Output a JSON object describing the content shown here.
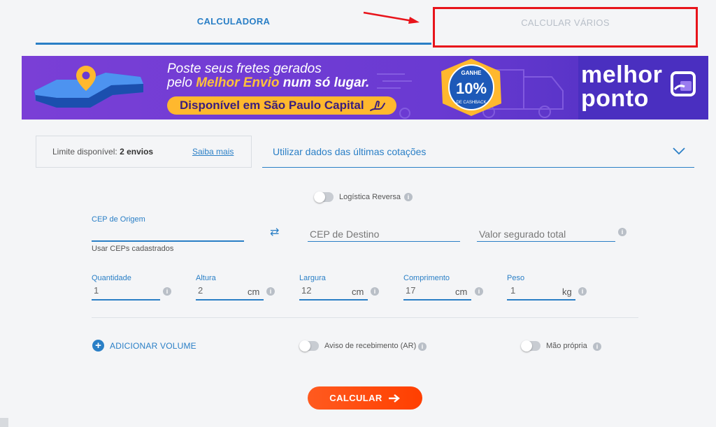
{
  "tabs": {
    "calculadora": "CALCULADORA",
    "calcular_varios": "CALCULAR VÁRIOS"
  },
  "banner": {
    "line1": "Poste seus fretes gerados",
    "line2_pre": "pelo ",
    "line2_brand": "Melhor Envio",
    "line2_post": " num só lugar.",
    "pill": "Disponível em São Paulo Capital",
    "badge_top": "GANHE",
    "badge_value": "10%",
    "badge_bottom": "DE CASHBACK",
    "brand_word1": "melhor",
    "brand_word2": "ponto"
  },
  "limit": {
    "label": "Limite disponível:",
    "value": "2 envios",
    "link": "Saiba mais"
  },
  "quotes": {
    "placeholder": "Utilizar dados das últimas cotações"
  },
  "reverse": {
    "label": "Logística Reversa"
  },
  "origin": {
    "label": "CEP de Origem",
    "value": "",
    "hint": "Usar CEPs cadastrados"
  },
  "destination": {
    "placeholder": "CEP de Destino"
  },
  "insured": {
    "placeholder": "Valor segurado total"
  },
  "dims": {
    "quantidade": {
      "label": "Quantidade",
      "value": "1"
    },
    "altura": {
      "label": "Altura",
      "value": "2",
      "unit": "cm"
    },
    "largura": {
      "label": "Largura",
      "value": "12",
      "unit": "cm"
    },
    "comprimento": {
      "label": "Comprimento",
      "value": "17",
      "unit": "cm"
    },
    "peso": {
      "label": "Peso",
      "value": "1",
      "unit": "kg"
    }
  },
  "options": {
    "add_volume": "ADICIONAR VOLUME",
    "aviso": "Aviso de recebimento (AR)",
    "mao_propria": "Mão própria"
  },
  "actions": {
    "calcular": "CALCULAR"
  },
  "colors": {
    "accent": "#2a7fc6",
    "cta": "#ff4a10",
    "highlight": "#e8141b"
  }
}
